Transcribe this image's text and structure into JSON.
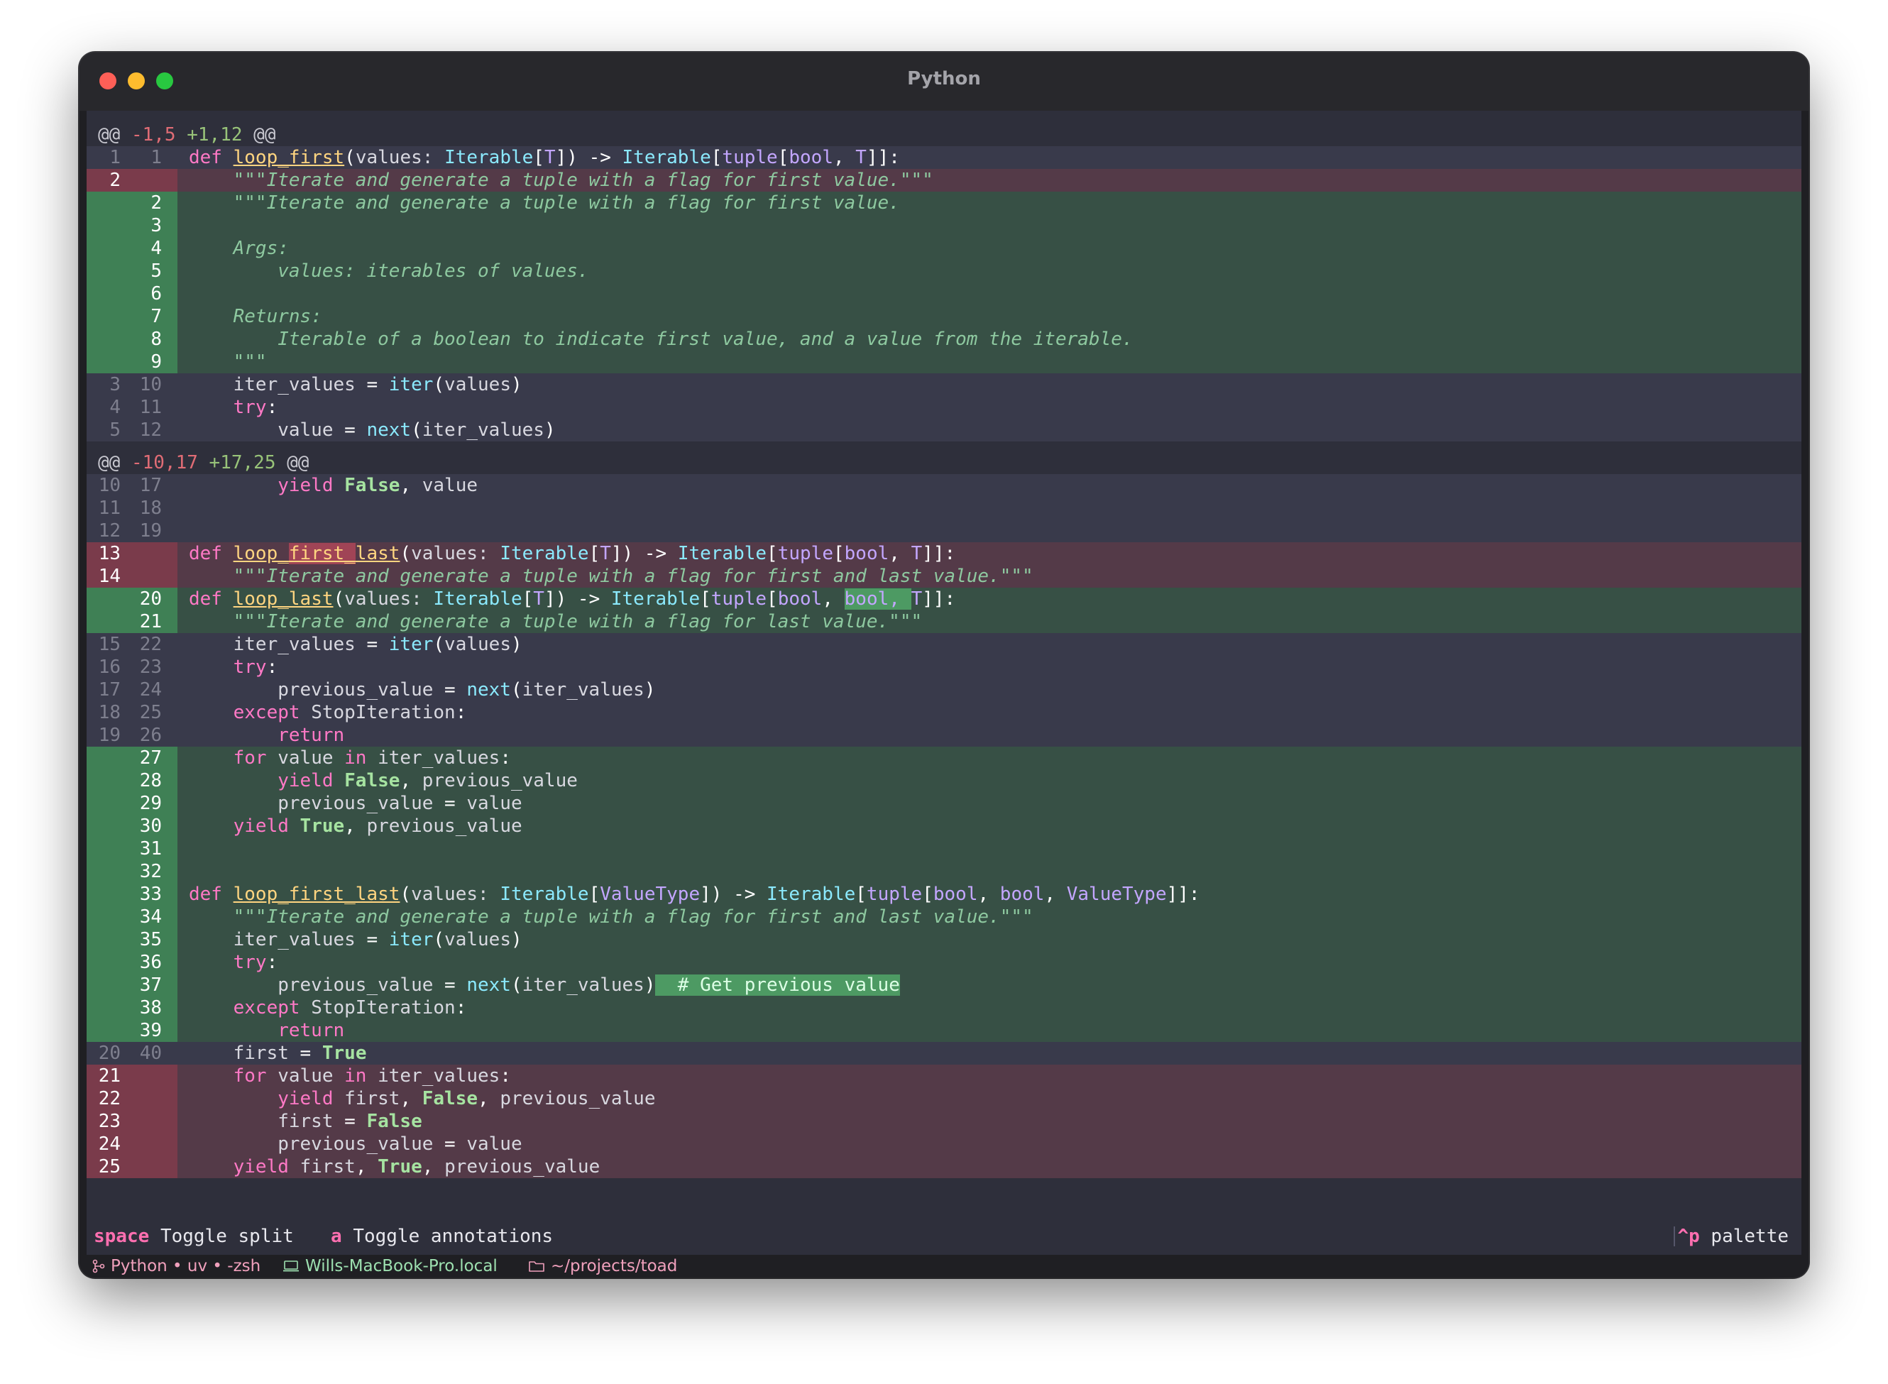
{
  "window": {
    "title": "Python"
  },
  "footer": {
    "k1": "space",
    "l1": "Toggle split",
    "k2": "a",
    "l2": "Toggle annotations",
    "k3": "^p",
    "l3": "palette"
  },
  "status": {
    "branch": "Python • uv • -zsh",
    "host": "Wills-MacBook-Pro.local",
    "dir": "~/projects/toad"
  },
  "diff": {
    "hunks": [
      "@@ -1,5 +1,12 @@",
      "@@ -10,17 +17,25 @@"
    ],
    "lines": [
      {
        "t": "ctx",
        "a": "1",
        "b": "1"
      },
      {
        "t": "del",
        "a": "2",
        "b": ""
      },
      {
        "t": "add",
        "a": "",
        "b": "2"
      },
      {
        "t": "add",
        "a": "",
        "b": "3"
      },
      {
        "t": "add",
        "a": "",
        "b": "4"
      },
      {
        "t": "add",
        "a": "",
        "b": "5"
      },
      {
        "t": "add",
        "a": "",
        "b": "6"
      },
      {
        "t": "add",
        "a": "",
        "b": "7"
      },
      {
        "t": "add",
        "a": "",
        "b": "8"
      },
      {
        "t": "add",
        "a": "",
        "b": "9"
      },
      {
        "t": "ctx",
        "a": "3",
        "b": "10"
      },
      {
        "t": "ctx",
        "a": "4",
        "b": "11"
      },
      {
        "t": "ctx",
        "a": "5",
        "b": "12"
      },
      {
        "t": "ctx",
        "a": "10",
        "b": "17"
      },
      {
        "t": "ctx",
        "a": "11",
        "b": "18"
      },
      {
        "t": "ctx",
        "a": "12",
        "b": "19"
      },
      {
        "t": "del",
        "a": "13",
        "b": ""
      },
      {
        "t": "del",
        "a": "14",
        "b": ""
      },
      {
        "t": "add",
        "a": "",
        "b": "20"
      },
      {
        "t": "add",
        "a": "",
        "b": "21"
      },
      {
        "t": "ctx",
        "a": "15",
        "b": "22"
      },
      {
        "t": "ctx",
        "a": "16",
        "b": "23"
      },
      {
        "t": "ctx",
        "a": "17",
        "b": "24"
      },
      {
        "t": "ctx",
        "a": "18",
        "b": "25"
      },
      {
        "t": "ctx",
        "a": "19",
        "b": "26"
      },
      {
        "t": "add",
        "a": "",
        "b": "27"
      },
      {
        "t": "add",
        "a": "",
        "b": "28"
      },
      {
        "t": "add",
        "a": "",
        "b": "29"
      },
      {
        "t": "add",
        "a": "",
        "b": "30"
      },
      {
        "t": "add",
        "a": "",
        "b": "31"
      },
      {
        "t": "add",
        "a": "",
        "b": "32"
      },
      {
        "t": "add",
        "a": "",
        "b": "33"
      },
      {
        "t": "add",
        "a": "",
        "b": "34"
      },
      {
        "t": "add",
        "a": "",
        "b": "35"
      },
      {
        "t": "add",
        "a": "",
        "b": "36"
      },
      {
        "t": "add",
        "a": "",
        "b": "37"
      },
      {
        "t": "add",
        "a": "",
        "b": "38"
      },
      {
        "t": "add",
        "a": "",
        "b": "39"
      },
      {
        "t": "ctx",
        "a": "20",
        "b": "40"
      },
      {
        "t": "del",
        "a": "21",
        "b": ""
      },
      {
        "t": "del",
        "a": "22",
        "b": ""
      },
      {
        "t": "del",
        "a": "23",
        "b": ""
      },
      {
        "t": "del",
        "a": "24",
        "b": ""
      },
      {
        "t": "del",
        "a": "25",
        "b": ""
      }
    ],
    "code": [
      [
        [
          "kw",
          "def "
        ],
        [
          "fn",
          "loop_first"
        ],
        [
          "op",
          "("
        ],
        [
          "var",
          "values: "
        ],
        [
          "bi",
          "Iterable"
        ],
        [
          "op",
          "["
        ],
        [
          "tk",
          "T"
        ],
        [
          "op",
          "]) -> "
        ],
        [
          "bi",
          "Iterable"
        ],
        [
          "op",
          "["
        ],
        [
          "ty",
          "tuple"
        ],
        [
          "op",
          "["
        ],
        [
          "ty",
          "bool"
        ],
        [
          "op",
          ", "
        ],
        [
          "tk",
          "T"
        ],
        [
          "op",
          "]]:"
        ]
      ],
      [
        [
          "dc",
          "    \"\"\"Iterate and generate a tuple with a flag for first value.\"\"\""
        ]
      ],
      [
        [
          "dc",
          "    \"\"\"Iterate and generate a tuple with a flag for first value."
        ]
      ],
      [],
      [
        [
          "dc",
          "    Args:"
        ]
      ],
      [
        [
          "dc",
          "        values: iterables of values."
        ]
      ],
      [],
      [
        [
          "dc",
          "    Returns:"
        ]
      ],
      [
        [
          "dc",
          "        Iterable of a boolean to indicate first value, and a value from the iterable."
        ]
      ],
      [
        [
          "dc",
          "    \"\"\""
        ]
      ],
      [
        [
          "var",
          "    iter_values "
        ],
        [
          "op",
          "= "
        ],
        [
          "bi",
          "iter"
        ],
        [
          "op",
          "("
        ],
        [
          "var",
          "values"
        ],
        [
          "op",
          ")"
        ]
      ],
      [
        [
          "kw",
          "    try"
        ],
        [
          "op",
          ":"
        ]
      ],
      [
        [
          "var",
          "        value "
        ],
        [
          "op",
          "= "
        ],
        [
          "bi",
          "next"
        ],
        [
          "op",
          "("
        ],
        [
          "var",
          "iter_values"
        ],
        [
          "op",
          ")"
        ]
      ],
      [
        [
          "kw",
          "        yield "
        ],
        [
          "cst",
          "False"
        ],
        [
          "op",
          ", "
        ],
        [
          "var",
          "value"
        ]
      ],
      [],
      [],
      [
        [
          "kw",
          "def "
        ],
        [
          "fn",
          "loop_"
        ],
        [
          "fn hl-del",
          "first_"
        ],
        [
          "fn",
          "last"
        ],
        [
          "op",
          "("
        ],
        [
          "var",
          "values: "
        ],
        [
          "bi",
          "Iterable"
        ],
        [
          "op",
          "["
        ],
        [
          "tk",
          "T"
        ],
        [
          "op",
          "]) -> "
        ],
        [
          "bi",
          "Iterable"
        ],
        [
          "op",
          "["
        ],
        [
          "ty",
          "tuple"
        ],
        [
          "op",
          "["
        ],
        [
          "ty",
          "bool"
        ],
        [
          "op",
          ", "
        ],
        [
          "tk",
          "T"
        ],
        [
          "op",
          "]]:"
        ]
      ],
      [
        [
          "dc",
          "    \"\"\"Iterate and generate a tuple with a flag for first and last value.\"\"\""
        ]
      ],
      [
        [
          "kw",
          "def "
        ],
        [
          "fn",
          "loop_last"
        ],
        [
          "op",
          "("
        ],
        [
          "var",
          "values: "
        ],
        [
          "bi",
          "Iterable"
        ],
        [
          "op",
          "["
        ],
        [
          "tk",
          "T"
        ],
        [
          "op",
          "]) -> "
        ],
        [
          "bi",
          "Iterable"
        ],
        [
          "op",
          "["
        ],
        [
          "ty",
          "tuple"
        ],
        [
          "op",
          "["
        ],
        [
          "ty",
          "bool"
        ],
        [
          "op",
          ", "
        ],
        [
          "ty hl-add",
          "bool, "
        ],
        [
          "tk",
          "T"
        ],
        [
          "op",
          "]]:"
        ]
      ],
      [
        [
          "dc",
          "    \"\"\"Iterate and generate a tuple with a flag for last value.\"\"\""
        ]
      ],
      [
        [
          "var",
          "    iter_values "
        ],
        [
          "op",
          "= "
        ],
        [
          "bi",
          "iter"
        ],
        [
          "op",
          "("
        ],
        [
          "var",
          "values"
        ],
        [
          "op",
          ")"
        ]
      ],
      [
        [
          "kw",
          "    try"
        ],
        [
          "op",
          ":"
        ]
      ],
      [
        [
          "var",
          "        previous_value "
        ],
        [
          "op",
          "= "
        ],
        [
          "bi",
          "next"
        ],
        [
          "op",
          "("
        ],
        [
          "var",
          "iter_values"
        ],
        [
          "op",
          ")"
        ]
      ],
      [
        [
          "kw",
          "    except "
        ],
        [
          "var",
          "StopIteration"
        ],
        [
          "op",
          ":"
        ]
      ],
      [
        [
          "kw",
          "        return"
        ]
      ],
      [
        [
          "kw",
          "    for "
        ],
        [
          "var",
          "value "
        ],
        [
          "kw",
          "in "
        ],
        [
          "var",
          "iter_values"
        ],
        [
          "op",
          ":"
        ]
      ],
      [
        [
          "kw",
          "        yield "
        ],
        [
          "cst",
          "False"
        ],
        [
          "op",
          ", "
        ],
        [
          "var",
          "previous_value"
        ]
      ],
      [
        [
          "var",
          "        previous_value "
        ],
        [
          "op",
          "= "
        ],
        [
          "var",
          "value"
        ]
      ],
      [
        [
          "kw",
          "    yield "
        ],
        [
          "cst",
          "True"
        ],
        [
          "op",
          ", "
        ],
        [
          "var",
          "previous_value"
        ]
      ],
      [],
      [],
      [
        [
          "kw",
          "def "
        ],
        [
          "fn",
          "loop_first_last"
        ],
        [
          "op",
          "("
        ],
        [
          "var",
          "values: "
        ],
        [
          "bi",
          "Iterable"
        ],
        [
          "op",
          "["
        ],
        [
          "tk",
          "ValueType"
        ],
        [
          "op",
          "]) -> "
        ],
        [
          "bi",
          "Iterable"
        ],
        [
          "op",
          "["
        ],
        [
          "ty",
          "tuple"
        ],
        [
          "op",
          "["
        ],
        [
          "ty",
          "bool"
        ],
        [
          "op",
          ", "
        ],
        [
          "ty",
          "bool"
        ],
        [
          "op",
          ", "
        ],
        [
          "tk",
          "ValueType"
        ],
        [
          "op",
          "]]:"
        ]
      ],
      [
        [
          "dc",
          "    \"\"\"Iterate and generate a tuple with a flag for first and last value.\"\"\""
        ]
      ],
      [
        [
          "var",
          "    iter_values "
        ],
        [
          "op",
          "= "
        ],
        [
          "bi",
          "iter"
        ],
        [
          "op",
          "("
        ],
        [
          "var",
          "values"
        ],
        [
          "op",
          ")"
        ]
      ],
      [
        [
          "kw",
          "    try"
        ],
        [
          "op",
          ":"
        ]
      ],
      [
        [
          "var",
          "        previous_value "
        ],
        [
          "op",
          "= "
        ],
        [
          "bi",
          "next"
        ],
        [
          "op",
          "("
        ],
        [
          "var",
          "iter_values"
        ],
        [
          "op",
          ")"
        ],
        [
          "cmt hl-add",
          "  # Get previous value"
        ]
      ],
      [
        [
          "kw",
          "    except "
        ],
        [
          "var",
          "StopIteration"
        ],
        [
          "op",
          ":"
        ]
      ],
      [
        [
          "kw",
          "        return"
        ]
      ],
      [
        [
          "var",
          "    first "
        ],
        [
          "op",
          "= "
        ],
        [
          "cst",
          "True"
        ]
      ],
      [
        [
          "kw",
          "    for "
        ],
        [
          "var",
          "value "
        ],
        [
          "kw",
          "in "
        ],
        [
          "var",
          "iter_values"
        ],
        [
          "op",
          ":"
        ]
      ],
      [
        [
          "kw",
          "        yield "
        ],
        [
          "var",
          "first"
        ],
        [
          "op",
          ", "
        ],
        [
          "cst",
          "False"
        ],
        [
          "op",
          ", "
        ],
        [
          "var",
          "previous_value"
        ]
      ],
      [
        [
          "var",
          "        first "
        ],
        [
          "op",
          "= "
        ],
        [
          "cst",
          "False"
        ]
      ],
      [
        [
          "var",
          "        previous_value "
        ],
        [
          "op",
          "= "
        ],
        [
          "var",
          "value"
        ]
      ],
      [
        [
          "kw",
          "    yield "
        ],
        [
          "var",
          "first"
        ],
        [
          "op",
          ", "
        ],
        [
          "cst",
          "True"
        ],
        [
          "op",
          ", "
        ],
        [
          "var",
          "previous_value"
        ]
      ]
    ]
  }
}
